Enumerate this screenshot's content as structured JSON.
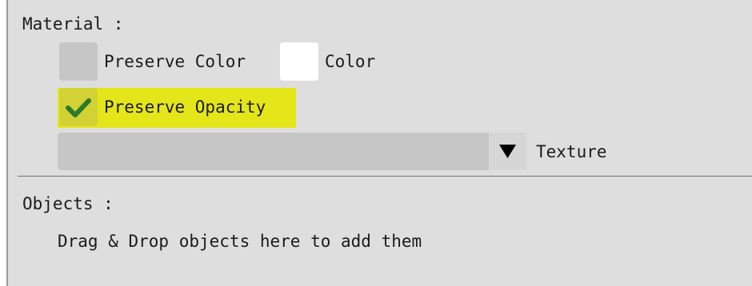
{
  "material": {
    "header": "Material :",
    "preserve_color": {
      "label": "Preserve Color",
      "checked": false
    },
    "color": {
      "label": "Color",
      "value": "#ffffff"
    },
    "preserve_opacity": {
      "label": "Preserve Opacity",
      "checked": true,
      "highlight_color": "#e5e619"
    },
    "texture": {
      "label": "Texture",
      "selected": "",
      "arrow": "▼"
    }
  },
  "objects": {
    "header": "Objects :",
    "hint": "Drag & Drop objects here to add them"
  },
  "icons": {
    "check": "check-icon",
    "dropdown": "triangle-down-icon"
  }
}
